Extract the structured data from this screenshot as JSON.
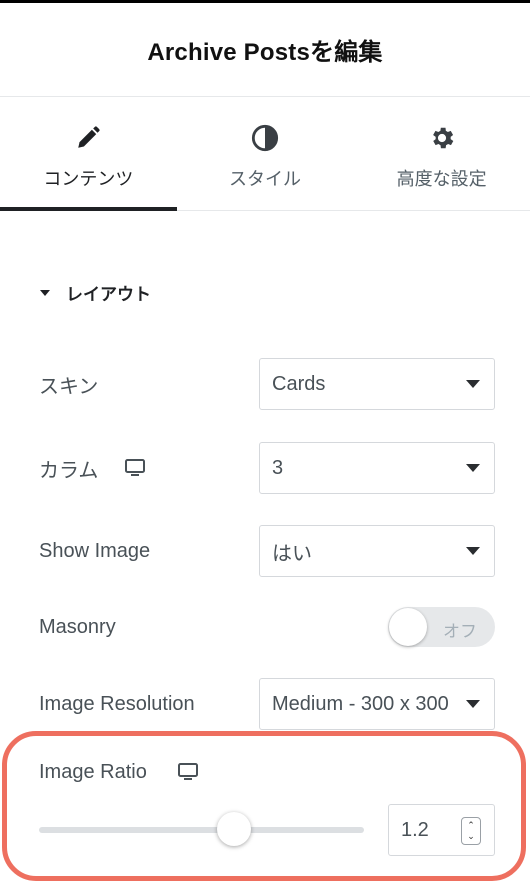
{
  "header": {
    "title": "Archive Postsを編集"
  },
  "tabs": [
    {
      "label": "コンテンツ",
      "icon": "pencil-icon",
      "active": true
    },
    {
      "label": "スタイル",
      "icon": "contrast-icon",
      "active": false
    },
    {
      "label": "高度な設定",
      "icon": "gear-icon",
      "active": false
    }
  ],
  "section": {
    "title": "レイアウト"
  },
  "controls": {
    "skin": {
      "label": "スキン",
      "value": "Cards"
    },
    "columns": {
      "label": "カラム",
      "value": "3",
      "icon": "monitor-icon"
    },
    "show_image": {
      "label": "Show Image",
      "value": "はい"
    },
    "masonry": {
      "label": "Masonry",
      "state": "オフ"
    },
    "image_resolution": {
      "label": "Image Resolution",
      "value": "Medium - 300 x 300"
    },
    "image_ratio": {
      "label": "Image Ratio",
      "value": "1.2",
      "slider_fraction": 0.6,
      "icon": "monitor-icon"
    }
  },
  "colors": {
    "highlight": "#ee6f5f",
    "text": "#495157",
    "active_tab": "#1f2124"
  }
}
